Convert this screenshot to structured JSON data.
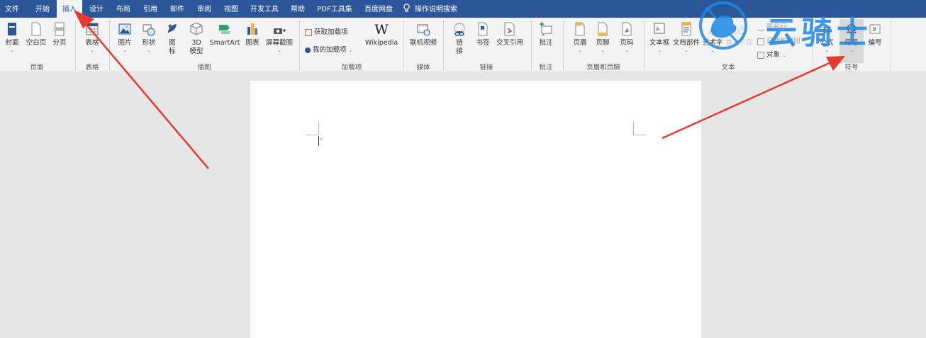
{
  "menu": {
    "tabs": [
      {
        "label": "文件"
      },
      {
        "label": "开始"
      },
      {
        "label": "插入"
      },
      {
        "label": "设计"
      },
      {
        "label": "布局"
      },
      {
        "label": "引用"
      },
      {
        "label": "邮件"
      },
      {
        "label": "审阅"
      },
      {
        "label": "视图"
      },
      {
        "label": "开发工具"
      },
      {
        "label": "帮助"
      },
      {
        "label": "PDF工具集"
      },
      {
        "label": "百度网盘"
      }
    ],
    "active_tab": "插入",
    "tell_me": "操作说明搜索"
  },
  "ribbon": {
    "pages": {
      "group": "页面",
      "cover": "封面",
      "blank": "空白页",
      "break": "分页"
    },
    "tables": {
      "group": "表格",
      "table": "表格"
    },
    "illustrations": {
      "group": "插图",
      "picture": "图片",
      "shape": "形状",
      "icon_l1": "图",
      "icon_l2": "标",
      "model_l1": "3D",
      "model_l2": "模型",
      "smartart": "SmartArt",
      "chart": "图表",
      "screenshot": "屏幕截图"
    },
    "addins": {
      "group": "加载项",
      "get": "获取加载项",
      "my": "我的加载项",
      "wiki": "Wikipedia"
    },
    "media": {
      "group": "媒体",
      "video": "联机视频"
    },
    "links": {
      "group": "链接",
      "link_l1": "链",
      "link_l2": "接",
      "bookmark": "书签",
      "crossref": "交叉引用"
    },
    "comments": {
      "group": "批注",
      "comment": "批注"
    },
    "header_footer": {
      "group": "页眉和页脚",
      "header": "页眉",
      "footer": "页脚",
      "page_number": "页码"
    },
    "text": {
      "group": "文本",
      "textbox": "文本框",
      "quickparts": "文档部件",
      "wordart": "艺术字",
      "dropcap": "首字下沉",
      "signature": "签名行",
      "datetime": "日期和时间",
      "object": "对象"
    },
    "symbols": {
      "group": "符号",
      "equation": "公式",
      "symbol": "符号",
      "number": "编号"
    }
  },
  "watermark": {
    "text": "云骑士"
  },
  "colors": {
    "accent": "#2b579a",
    "arrow": "#e8382f",
    "watermark": "#1e88e5"
  }
}
